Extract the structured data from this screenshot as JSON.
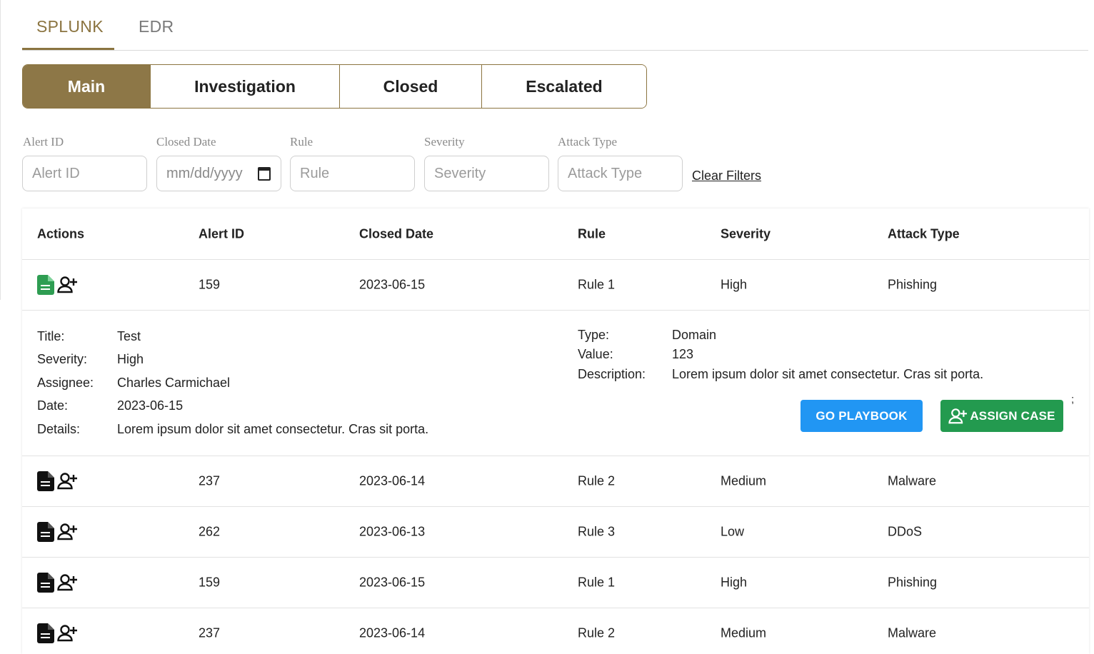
{
  "top_tabs": [
    {
      "label": "SPLUNK",
      "active": true
    },
    {
      "label": "EDR",
      "active": false
    }
  ],
  "sub_tabs": [
    {
      "label": "Main",
      "active": true
    },
    {
      "label": "Investigation",
      "active": false
    },
    {
      "label": "Closed",
      "active": false
    },
    {
      "label": "Escalated",
      "active": false
    }
  ],
  "filters": {
    "alert_id": {
      "label": "Alert ID",
      "placeholder": "Alert ID"
    },
    "closed_date": {
      "label": "Closed Date",
      "placeholder": "mm/dd/yyyy"
    },
    "rule": {
      "label": "Rule",
      "placeholder": "Rule"
    },
    "severity": {
      "label": "Severity",
      "placeholder": "Severity"
    },
    "attack_type": {
      "label": "Attack Type",
      "placeholder": "Attack Type"
    },
    "clear_label": "Clear Filters"
  },
  "table": {
    "headers": [
      "Actions",
      "Alert ID",
      "Closed Date",
      "Rule",
      "Severity",
      "Attack Type"
    ],
    "rows": [
      {
        "alert_id": "159",
        "closed_date": "2023-06-15",
        "rule": "Rule 1",
        "severity": "High",
        "attack_type": "Phishing",
        "doc_icon_color": "#2e9d52"
      },
      {
        "alert_id": "237",
        "closed_date": "2023-06-14",
        "rule": "Rule 2",
        "severity": "Medium",
        "attack_type": "Malware",
        "doc_icon_color": "#111111"
      },
      {
        "alert_id": "262",
        "closed_date": "2023-06-13",
        "rule": "Rule 3",
        "severity": "Low",
        "attack_type": "DDoS",
        "doc_icon_color": "#111111"
      },
      {
        "alert_id": "159",
        "closed_date": "2023-06-15",
        "rule": "Rule 1",
        "severity": "High",
        "attack_type": "Phishing",
        "doc_icon_color": "#111111"
      },
      {
        "alert_id": "237",
        "closed_date": "2023-06-14",
        "rule": "Rule 2",
        "severity": "Medium",
        "attack_type": "Malware",
        "doc_icon_color": "#111111"
      }
    ]
  },
  "detail": {
    "left": [
      {
        "key": "Title:",
        "value": "Test"
      },
      {
        "key": "Severity:",
        "value": "High"
      },
      {
        "key": "Assignee:",
        "value": "Charles Carmichael"
      },
      {
        "key": "Date:",
        "value": "2023-06-15"
      },
      {
        "key": "Details:",
        "value": "Lorem ipsum dolor sit amet consectetur. Cras sit porta."
      }
    ],
    "right": [
      {
        "key": "Type:",
        "value": "Domain"
      },
      {
        "key": "Value:",
        "value": "123"
      },
      {
        "key": "Description:",
        "value": "Lorem ipsum dolor sit amet consectetur. Cras sit porta."
      }
    ],
    "playbook_label": "GO PLAYBOOK",
    "assign_label": "ASSIGN CASE",
    "stray_text": ";"
  },
  "icons": {
    "document": "document-icon",
    "assign_user": "person-add-icon",
    "calendar": "calendar-icon"
  },
  "colors": {
    "accent": "#8b7440",
    "active_tab_bg": "#8d7747",
    "playbook_button": "#2196f3",
    "assign_button": "#239a4f"
  }
}
